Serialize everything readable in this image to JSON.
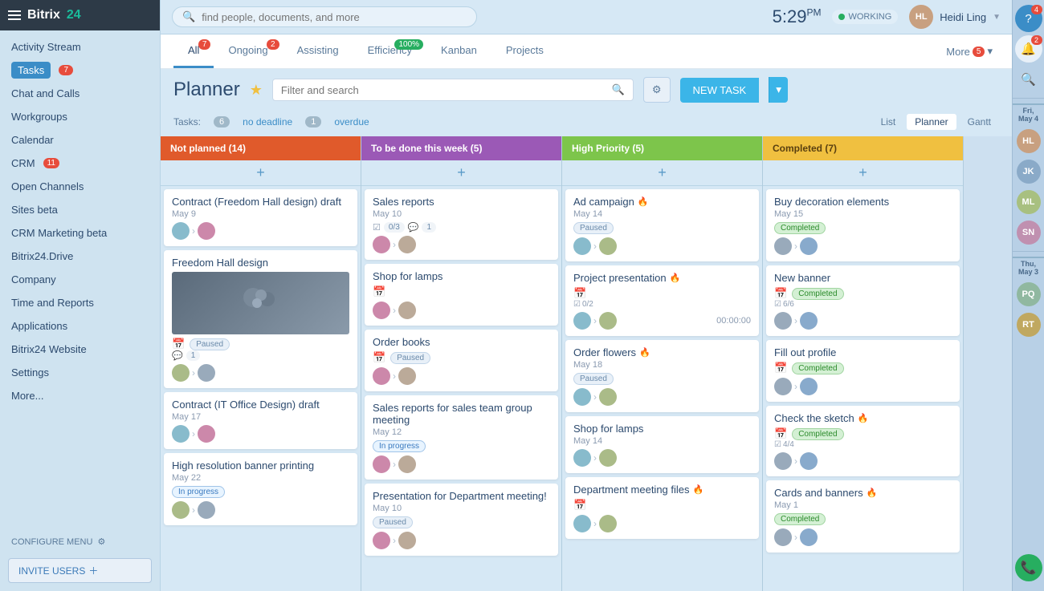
{
  "app": {
    "name": "Bitrix",
    "name2": "24"
  },
  "sidebar": {
    "items": [
      {
        "label": "Activity Stream",
        "badge": null
      },
      {
        "label": "Tasks",
        "badge": "7",
        "active": true
      },
      {
        "label": "Chat and Calls",
        "badge": null
      },
      {
        "label": "Workgroups",
        "badge": null
      },
      {
        "label": "Calendar",
        "badge": null
      },
      {
        "label": "CRM",
        "badge": "11"
      },
      {
        "label": "Open Channels",
        "badge": null
      },
      {
        "label": "Sites beta",
        "badge": null
      },
      {
        "label": "CRM Marketing beta",
        "badge": null
      },
      {
        "label": "Bitrix24.Drive",
        "badge": null
      },
      {
        "label": "Company",
        "badge": null
      },
      {
        "label": "Time and Reports",
        "badge": null
      },
      {
        "label": "Applications",
        "badge": null
      },
      {
        "label": "Bitrix24 Website",
        "badge": null
      },
      {
        "label": "Settings",
        "badge": null
      },
      {
        "label": "More...",
        "badge": null
      }
    ],
    "configure_label": "CONFIGURE MENU",
    "invite_label": "INVITE USERS"
  },
  "topbar": {
    "search_placeholder": "find people, documents, and more",
    "time": "5:29",
    "time_suffix": "PM",
    "status": "WORKING",
    "user_name": "Heidi Ling"
  },
  "tabs": {
    "items": [
      {
        "label": "All",
        "badge": "7",
        "active": true
      },
      {
        "label": "Ongoing",
        "badge": "2"
      },
      {
        "label": "Assisting",
        "badge": null
      },
      {
        "label": "Efficiency",
        "badge": "100%",
        "badge_color": "green"
      },
      {
        "label": "Kanban",
        "badge": null
      },
      {
        "label": "Projects",
        "badge": null
      }
    ],
    "more_label": "More",
    "more_badge": "5"
  },
  "planner": {
    "title": "Planner",
    "filter_placeholder": "Filter and search",
    "new_task_label": "NEW TASK",
    "stats": {
      "label": "Tasks:",
      "no_deadline_count": "6",
      "no_deadline_label": "no deadline",
      "overdue_count": "1",
      "overdue_label": "overdue"
    },
    "views": [
      "List",
      "Planner",
      "Gantt"
    ],
    "active_view": "Planner"
  },
  "columns": [
    {
      "id": "not-planned",
      "title": "Not planned",
      "count": "14",
      "color": "red",
      "cards": [
        {
          "title": "Contract (Freedom Hall design) draft",
          "date": "May 9",
          "avatars": [
            "av1",
            "av2"
          ],
          "badge": null
        },
        {
          "title": "Freedom Hall design",
          "date": null,
          "has_image": true,
          "badge": "Paused",
          "badge_type": "paused",
          "counter": "1",
          "avatars": [
            "av3",
            "av4"
          ]
        },
        {
          "title": "Contract (IT Office Design) draft",
          "date": "May 17",
          "avatars": [
            "av1",
            "av2"
          ],
          "badge": null
        },
        {
          "title": "High resolution banner printing",
          "date": "May 22",
          "badge": "In progress",
          "badge_type": "progress",
          "avatars": [
            "av3",
            "av4"
          ]
        }
      ]
    },
    {
      "id": "to-be-done",
      "title": "To be done this week",
      "count": "5",
      "color": "purple",
      "cards": [
        {
          "title": "Sales reports",
          "date": "May 10",
          "check": "0/3",
          "msg": "1",
          "avatars": [
            "av2",
            "av5"
          ]
        },
        {
          "title": "Shop for lamps",
          "date": null,
          "has_cal": true,
          "avatars": [
            "av2",
            "av5"
          ]
        },
        {
          "title": "Order books",
          "date": null,
          "badge": "Paused",
          "badge_type": "paused",
          "has_cal": true,
          "avatars": [
            "av2",
            "av5"
          ]
        },
        {
          "title": "Sales reports for sales team group meeting",
          "date": "May 12",
          "badge": "In progress",
          "badge_type": "progress",
          "avatars": [
            "av2",
            "av5"
          ]
        },
        {
          "title": "Presentation for Department meeting!",
          "date": "May 10",
          "badge": "Paused",
          "badge_type": "paused",
          "avatars": [
            "av2",
            "av5"
          ]
        }
      ]
    },
    {
      "id": "high-priority",
      "title": "High Priority",
      "count": "5",
      "color": "green",
      "cards": [
        {
          "title": "Ad campaign",
          "fire": true,
          "date": "May 14",
          "badge": "Paused",
          "badge_type": "paused",
          "avatars": [
            "av1",
            "av3"
          ]
        },
        {
          "title": "Project presentation",
          "fire": true,
          "date": null,
          "has_cal": true,
          "check2": "0/2",
          "timer": "00:00:00",
          "avatars": [
            "av1",
            "av3"
          ]
        },
        {
          "title": "Order flowers",
          "fire": true,
          "date": "May 18",
          "badge": "Paused",
          "badge_type": "paused",
          "avatars": [
            "av1",
            "av3"
          ]
        },
        {
          "title": "Shop for lamps",
          "date": "May 14",
          "avatars": [
            "av1",
            "av3"
          ]
        },
        {
          "title": "Department meeting files",
          "fire": true,
          "date": null,
          "has_cal": true,
          "avatars": [
            "av1",
            "av3"
          ]
        }
      ]
    },
    {
      "id": "completed",
      "title": "Completed",
      "count": "7",
      "color": "yellow",
      "cards": [
        {
          "title": "Buy decoration elements",
          "date": "May 15",
          "badge": "Completed",
          "badge_type": "completed",
          "avatars": [
            "av4",
            "av6"
          ]
        },
        {
          "title": "New banner",
          "date": null,
          "badge": "Completed",
          "badge_type": "completed",
          "check3": "6/6",
          "avatars": [
            "av4",
            "av6"
          ]
        },
        {
          "title": "Fill out profile",
          "date": null,
          "has_cal": true,
          "badge": "Completed",
          "badge_type": "completed",
          "avatars": [
            "av4",
            "av6"
          ]
        },
        {
          "title": "Check the sketch",
          "fire": true,
          "date": null,
          "badge": "Completed",
          "badge_type": "completed",
          "check4": "4/4",
          "avatars": [
            "av4",
            "av6"
          ]
        },
        {
          "title": "Cards and banners",
          "fire": true,
          "date": "May 1",
          "badge": "Completed",
          "badge_type": "completed",
          "avatars": [
            "av4",
            "av6"
          ]
        }
      ]
    }
  ],
  "right_panel": {
    "icons": [
      "question",
      "bell",
      "search",
      "avatar1",
      "avatar2",
      "avatar3",
      "avatar4",
      "avatar5",
      "avatar6",
      "avatar7"
    ],
    "date_fri": "Fri, May 4",
    "date_thu": "Thu, May 3",
    "question_badge": "4",
    "bell_badge": "2",
    "phone_color": "#27ae60"
  }
}
